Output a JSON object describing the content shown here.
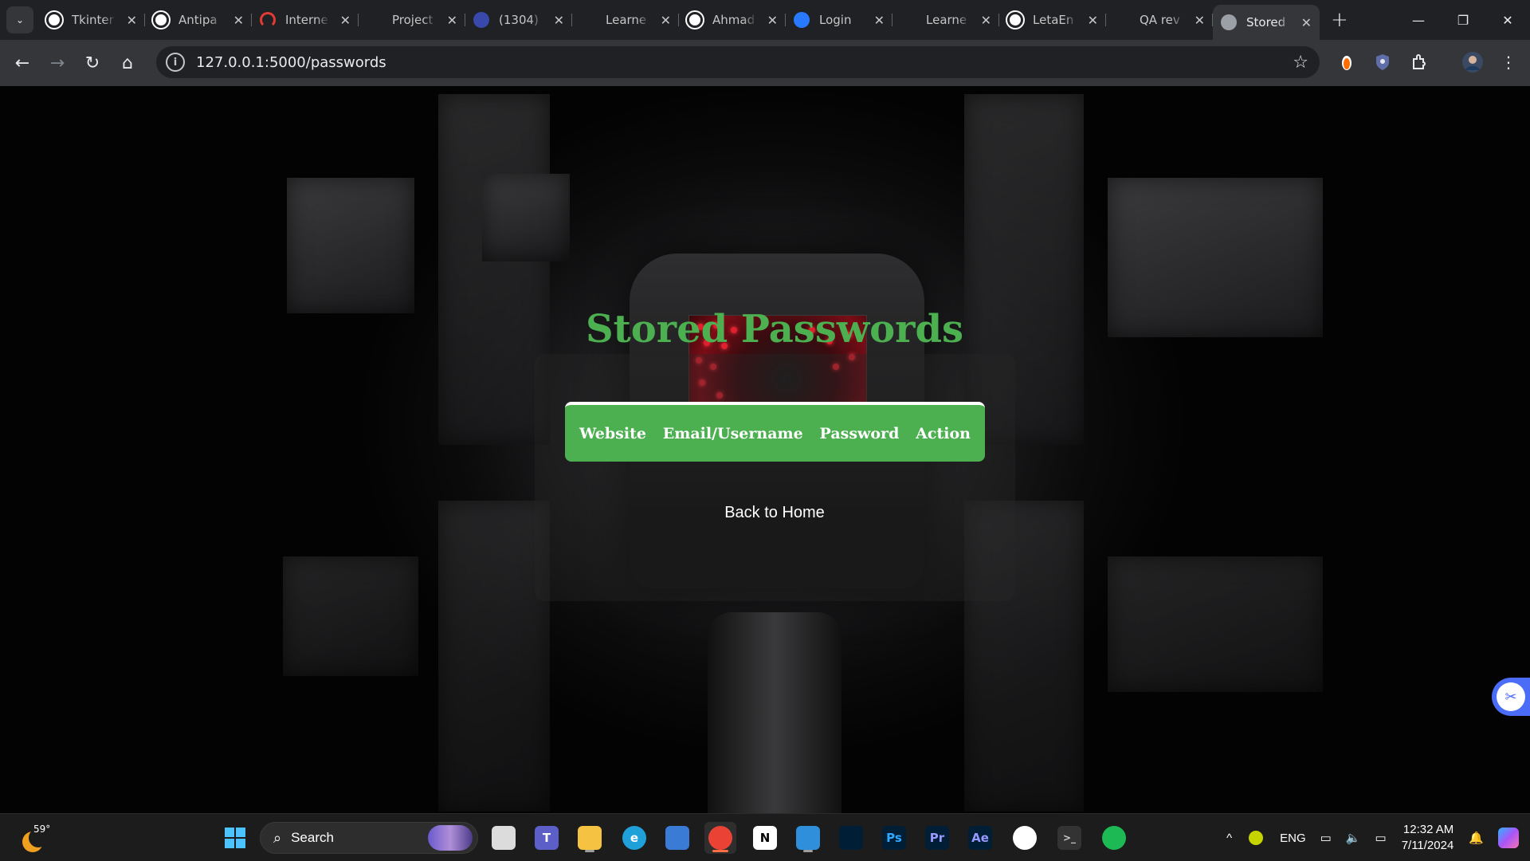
{
  "browser": {
    "tab_search_icon": "chevron-down",
    "tabs": [
      {
        "title": "Tkinter",
        "favicon": "openai",
        "favicon_color": "#ffffff"
      },
      {
        "title": "Antipa",
        "favicon": "github",
        "favicon_color": "#ffffff"
      },
      {
        "title": "Interne",
        "favicon": "speedometer",
        "favicon_color": "#e53935"
      },
      {
        "title": "Project",
        "favicon": "blank",
        "favicon_color": "#202124"
      },
      {
        "title": "(1304)",
        "favicon": "badge-1k",
        "favicon_color": "#3949ab"
      },
      {
        "title": "Learne",
        "favicon": "blank",
        "favicon_color": "#202124"
      },
      {
        "title": "Ahmad",
        "favicon": "github",
        "favicon_color": "#ffffff"
      },
      {
        "title": "Login",
        "favicon": "c-logo",
        "favicon_color": "#2979ff"
      },
      {
        "title": "Learne",
        "favicon": "blank",
        "favicon_color": "#202124"
      },
      {
        "title": "LetaEn",
        "favicon": "github",
        "favicon_color": "#ffffff"
      },
      {
        "title": "QA rev",
        "favicon": "blank",
        "favicon_color": "#202124"
      },
      {
        "title": "Stored",
        "favicon": "globe",
        "favicon_color": "#9aa0a6",
        "active": true
      }
    ],
    "new_tab_label": "+",
    "window_controls": {
      "minimize": "—",
      "restore": "❐",
      "close": "✕"
    },
    "url": "127.0.0.1:5000/passwords"
  },
  "page": {
    "title": "Stored Passwords",
    "table_headers": [
      "Website",
      "Email/Username",
      "Password",
      "Action"
    ],
    "back_link": "Back to Home",
    "accent_color": "#4caf50"
  },
  "taskbar": {
    "weather_temp": "59°",
    "search_label": "Search",
    "apps": [
      {
        "name": "task-view",
        "label": "",
        "color": "#dcdcdc"
      },
      {
        "name": "teams",
        "label": "T",
        "color": "#5b5fc7"
      },
      {
        "name": "file-explorer",
        "label": "",
        "color": "#f5c242"
      },
      {
        "name": "edge",
        "label": "e",
        "color": "#1fa0d8"
      },
      {
        "name": "microsoft-store",
        "label": "",
        "color": "#3a7bd5"
      },
      {
        "name": "chrome",
        "label": "",
        "color": "#ea4335"
      },
      {
        "name": "notion",
        "label": "N",
        "color": "#ffffff"
      },
      {
        "name": "vs-code",
        "label": "",
        "color": "#2f8fdb"
      },
      {
        "name": "davinci-resolve",
        "label": "",
        "color": "#2b3a55"
      },
      {
        "name": "photoshop",
        "label": "Ps",
        "color": "#31a8ff"
      },
      {
        "name": "premiere-pro",
        "label": "Pr",
        "color": "#9999ff"
      },
      {
        "name": "after-effects",
        "label": "Ae",
        "color": "#9999ff"
      },
      {
        "name": "capcut",
        "label": "",
        "color": "#ffffff"
      },
      {
        "name": "terminal",
        "label": ">_",
        "color": "#cccccc"
      },
      {
        "name": "spotify",
        "label": "",
        "color": "#1db954"
      }
    ],
    "tray": {
      "language": "ENG",
      "time": "12:32 AM",
      "date": "7/11/2024"
    }
  }
}
